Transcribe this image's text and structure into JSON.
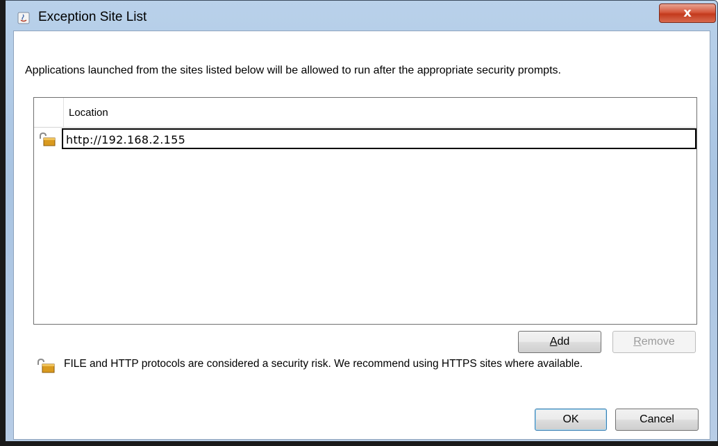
{
  "window": {
    "title": "Exception Site List",
    "close_label": "x"
  },
  "description": "Applications launched from the sites listed below will be allowed to run after the appropriate security prompts.",
  "table": {
    "column_header": "Location",
    "rows": [
      {
        "url": "http://192.168.2.155",
        "icon": "insecure-lock-icon"
      }
    ]
  },
  "buttons": {
    "add_prefix": "",
    "add_mnemonic": "A",
    "add_rest": "dd",
    "remove_mnemonic": "R",
    "remove_rest": "emove",
    "ok": "OK",
    "cancel": "Cancel"
  },
  "warning": {
    "icon": "insecure-lock-icon",
    "text": "FILE and HTTP protocols are considered a security risk.  We recommend using HTTPS sites where available."
  },
  "colors": {
    "titlebar": "#b9d1ea",
    "close_button": "#c33a1d",
    "lock_body": "#d99a1f"
  }
}
